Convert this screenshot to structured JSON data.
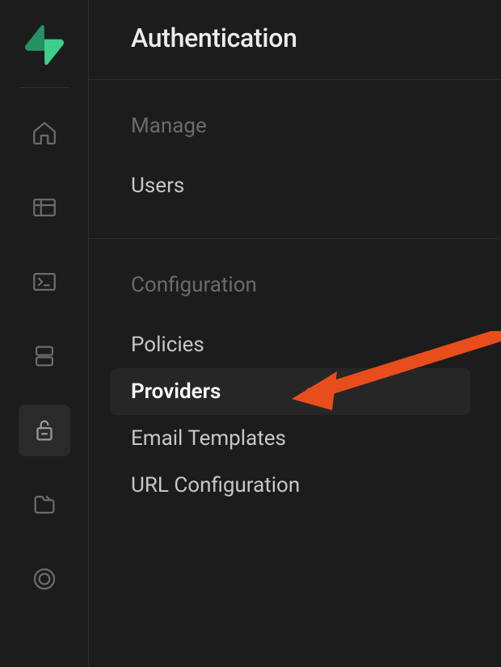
{
  "header": {
    "title": "Authentication"
  },
  "sections": [
    {
      "label": "Manage",
      "items": [
        {
          "label": "Users",
          "active": false
        }
      ]
    },
    {
      "label": "Configuration",
      "items": [
        {
          "label": "Policies",
          "active": false
        },
        {
          "label": "Providers",
          "active": true
        },
        {
          "label": "Email Templates",
          "active": false
        },
        {
          "label": "URL Configuration",
          "active": false
        }
      ]
    }
  ],
  "rail": {
    "items": [
      {
        "name": "home-icon",
        "active": false
      },
      {
        "name": "table-icon",
        "active": false
      },
      {
        "name": "terminal-icon",
        "active": false
      },
      {
        "name": "database-icon",
        "active": false
      },
      {
        "name": "lock-icon",
        "active": true
      },
      {
        "name": "folder-icon",
        "active": false
      },
      {
        "name": "globe-icon",
        "active": false
      }
    ]
  },
  "colors": {
    "accent": "#3ECF8E",
    "arrow": "#E84E1C"
  }
}
